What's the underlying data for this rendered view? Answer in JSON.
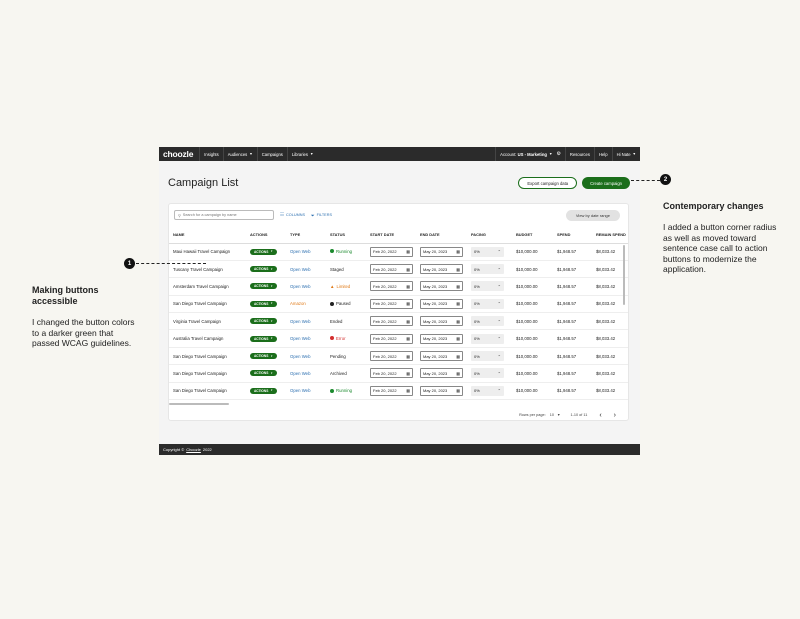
{
  "nav": {
    "logo": "choozle",
    "items": [
      {
        "label": "Insights",
        "chevron": false
      },
      {
        "label": "Audiences",
        "chevron": true
      },
      {
        "label": "Campaigns",
        "chevron": false
      },
      {
        "label": "Libraries",
        "chevron": true
      }
    ],
    "account_prefix": "Account:",
    "account_value": "US - Marketing",
    "resources": "Resources",
    "help": "Help",
    "user": "Hi Nate"
  },
  "page": {
    "title": "Campaign List",
    "export_button": "Export campaign data",
    "create_button": "Create campaign"
  },
  "toolbar": {
    "search_placeholder": "Search for a campaign by name",
    "columns_label": "COLUMNS",
    "filters_label": "FILTERS",
    "date_range_button": "View by date range"
  },
  "table": {
    "headers": [
      "NAME",
      "ACTIONS",
      "TYPE",
      "STATUS",
      "START DATE",
      "END DATE",
      "PACING",
      "BUDGET",
      "SPEND",
      "REMAIN SPEND"
    ],
    "rows": [
      {
        "name": "Maui Hawaii Travel Campaign",
        "action": "ACTIONS",
        "type": "Open Web",
        "type_style": "link",
        "status": "Running",
        "status_dot": "#1b8a2e",
        "status_icon": "dot",
        "status_color": "#1b8a2e",
        "start": "Feb 20, 2022",
        "end": "May 20, 2023",
        "pacing": "0%",
        "budget": "$10,000.00",
        "spend": "$1,948.57",
        "remain": "$8,033.42"
      },
      {
        "name": "Tuscany Travel Campaign",
        "action": "ACTIONS",
        "type": "Open Web",
        "type_style": "link",
        "status": "Staged",
        "status_dot": "",
        "status_icon": "none",
        "status_color": "#222222",
        "start": "Feb 20, 2022",
        "end": "May 20, 2023",
        "pacing": "0%",
        "budget": "$10,000.00",
        "spend": "$1,948.57",
        "remain": "$8,033.42"
      },
      {
        "name": "Amsterdam Travel Campaign",
        "action": "ACTIONS",
        "type": "Open Web",
        "type_style": "link",
        "status": "Limited",
        "status_dot": "#e07b1a",
        "status_icon": "warning",
        "status_color": "#e07b1a",
        "start": "Feb 20, 2022",
        "end": "May 20, 2023",
        "pacing": "0%",
        "budget": "$10,000.00",
        "spend": "$1,948.57",
        "remain": "$8,033.42"
      },
      {
        "name": "San Diego Travel Campaign",
        "action": "ACTIONS",
        "type": "Amazon",
        "type_style": "amazon",
        "status": "Paused",
        "status_dot": "#222222",
        "status_icon": "dot",
        "status_color": "#222222",
        "start": "Feb 20, 2022",
        "end": "May 20, 2023",
        "pacing": "0%",
        "budget": "$10,000.00",
        "spend": "$1,948.57",
        "remain": "$8,033.42"
      },
      {
        "name": "Virginia Travel Campaign",
        "action": "ACTIONS",
        "type": "Open Web",
        "type_style": "link",
        "status": "Ended",
        "status_dot": "",
        "status_icon": "none",
        "status_color": "#222222",
        "start": "Feb 20, 2022",
        "end": "May 20, 2023",
        "pacing": "0%",
        "budget": "$10,000.00",
        "spend": "$1,948.57",
        "remain": "$8,033.42"
      },
      {
        "name": "Australia Travel Campaign",
        "action": "ACTIONS",
        "type": "Open Web",
        "type_style": "link",
        "status": "Error",
        "status_dot": "#d32f2f",
        "status_icon": "dot",
        "status_color": "#d32f2f",
        "start": "Feb 20, 2022",
        "end": "May 20, 2023",
        "pacing": "0%",
        "budget": "$10,000.00",
        "spend": "$1,948.57",
        "remain": "$8,033.42"
      },
      {
        "name": "San Diego Travel Campaign",
        "action": "ACTIONS",
        "type": "Open Web",
        "type_style": "link",
        "status": "Pending",
        "status_dot": "",
        "status_icon": "none",
        "status_color": "#222222",
        "start": "Feb 20, 2022",
        "end": "May 20, 2023",
        "pacing": "0%",
        "budget": "$10,000.00",
        "spend": "$1,948.57",
        "remain": "$8,033.42"
      },
      {
        "name": "San Diego Travel Campaign",
        "action": "ACTIONS",
        "type": "Open Web",
        "type_style": "link",
        "status": "Archived",
        "status_dot": "",
        "status_icon": "none",
        "status_color": "#222222",
        "start": "Feb 20, 2022",
        "end": "May 20, 2023",
        "pacing": "0%",
        "budget": "$10,000.00",
        "spend": "$1,948.57",
        "remain": "$8,033.42"
      },
      {
        "name": "San Diego Travel Campaign",
        "action": "ACTIONS",
        "type": "Open Web",
        "type_style": "link",
        "status": "Running",
        "status_dot": "#1b8a2e",
        "status_icon": "dot",
        "status_color": "#1b8a2e",
        "start": "Feb 20, 2022",
        "end": "May 20, 2023",
        "pacing": "0%",
        "budget": "$10,000.00",
        "spend": "$1,948.57",
        "remain": "$8,033.42"
      }
    ]
  },
  "pagination": {
    "rows_label": "Rows per page:",
    "rows_value": "10",
    "range": "1-10 of 11"
  },
  "footer": {
    "prefix": "Copyright ©",
    "link": "Choozle",
    "year": "2022"
  },
  "annotations": {
    "left": {
      "number": "1",
      "title": "Making buttons accessible",
      "text": "I changed the button colors to a darker green that passed WCAG guidelines."
    },
    "right": {
      "number": "2",
      "title": "Contemporary changes",
      "text": "I added a button corner radius as well as moved toward sentence case call to action buttons to modernize the application."
    }
  },
  "colors": {
    "accent_green": "#1b6e1b",
    "nav_bg": "#2b2b2b",
    "link_blue": "#2c6fb0",
    "amazon_orange": "#e07b1a"
  }
}
